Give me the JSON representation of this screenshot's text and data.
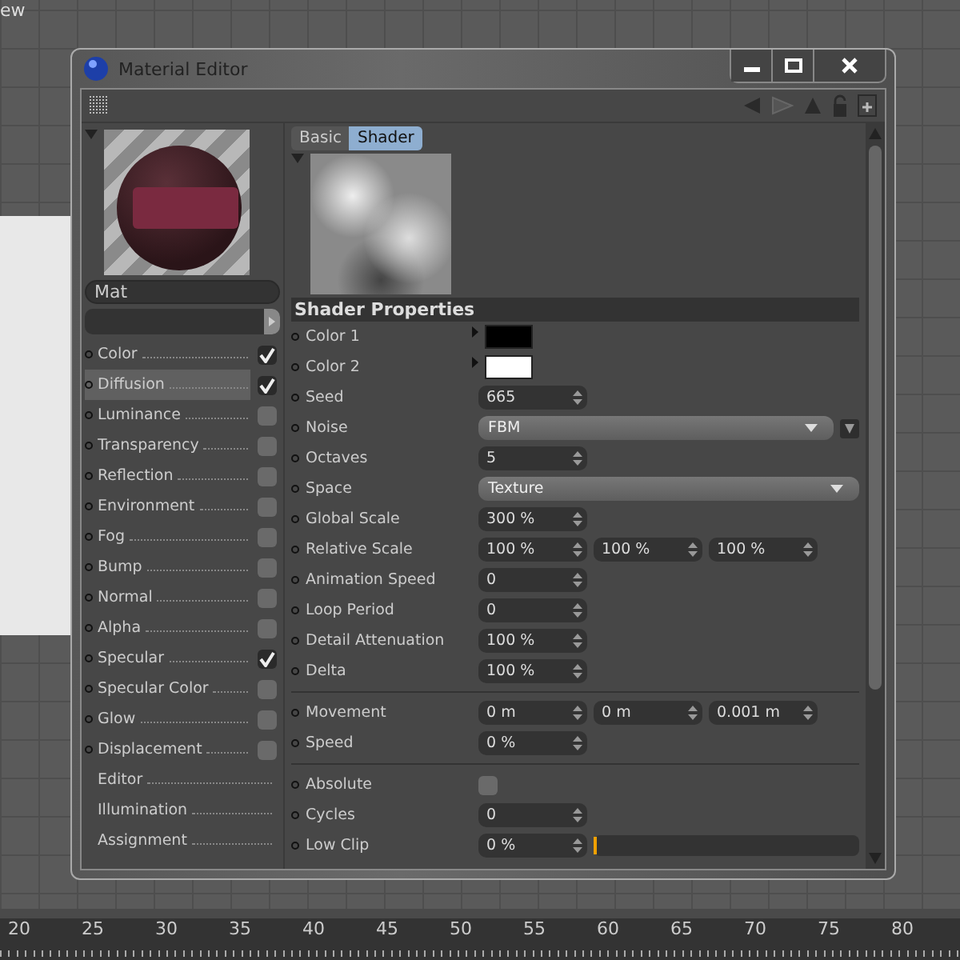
{
  "viewport": {
    "menu_label": "ew"
  },
  "window": {
    "title": "Material Editor"
  },
  "material": {
    "name": "Mat"
  },
  "channels": [
    {
      "kind": "channel",
      "label": "Color",
      "checked": true,
      "selected": false
    },
    {
      "kind": "channel",
      "label": "Diffusion",
      "checked": true,
      "selected": true
    },
    {
      "kind": "channel",
      "label": "Luminance",
      "checked": false,
      "selected": false
    },
    {
      "kind": "channel",
      "label": "Transparency",
      "checked": false,
      "selected": false
    },
    {
      "kind": "channel",
      "label": "Reflection",
      "checked": false,
      "selected": false
    },
    {
      "kind": "channel",
      "label": "Environment",
      "checked": false,
      "selected": false
    },
    {
      "kind": "channel",
      "label": "Fog",
      "checked": false,
      "selected": false
    },
    {
      "kind": "channel",
      "label": "Bump",
      "checked": false,
      "selected": false
    },
    {
      "kind": "channel",
      "label": "Normal",
      "checked": false,
      "selected": false
    },
    {
      "kind": "channel",
      "label": "Alpha",
      "checked": false,
      "selected": false
    },
    {
      "kind": "channel",
      "label": "Specular",
      "checked": true,
      "selected": false
    },
    {
      "kind": "channel",
      "label": "Specular Color",
      "checked": false,
      "selected": false
    },
    {
      "kind": "channel",
      "label": "Glow",
      "checked": false,
      "selected": false
    },
    {
      "kind": "channel",
      "label": "Displacement",
      "checked": false,
      "selected": false
    },
    {
      "kind": "page",
      "label": "Editor",
      "selected": false
    },
    {
      "kind": "page",
      "label": "Illumination",
      "selected": false
    },
    {
      "kind": "page",
      "label": "Assignment",
      "selected": false
    }
  ],
  "tabs": [
    {
      "label": "Basic",
      "selected": false
    },
    {
      "label": "Shader",
      "selected": true
    }
  ],
  "section": {
    "title": "Shader Properties"
  },
  "groups": [
    [
      {
        "kind": "color",
        "label": "Color 1",
        "color": "#000000"
      },
      {
        "kind": "color",
        "label": "Color 2",
        "color": "#ffffff"
      },
      {
        "kind": "number",
        "label": "Seed",
        "values": [
          "665"
        ]
      },
      {
        "kind": "dropdown",
        "label": "Noise",
        "value": "FBM",
        "extra": true
      },
      {
        "kind": "number",
        "label": "Octaves",
        "values": [
          "5"
        ]
      },
      {
        "kind": "dropdown",
        "label": "Space",
        "value": "Texture",
        "extra": false
      },
      {
        "kind": "number",
        "label": "Global Scale",
        "values": [
          "300 %"
        ]
      },
      {
        "kind": "number",
        "label": "Relative Scale",
        "values": [
          "100 %",
          "100 %",
          "100 %"
        ]
      },
      {
        "kind": "number",
        "label": "Animation Speed",
        "values": [
          "0"
        ]
      },
      {
        "kind": "number",
        "label": "Loop Period",
        "values": [
          "0"
        ]
      },
      {
        "kind": "number",
        "label": "Detail Attenuation",
        "values": [
          "100 %"
        ]
      },
      {
        "kind": "number",
        "label": "Delta",
        "values": [
          "100 %"
        ]
      }
    ],
    [
      {
        "kind": "number",
        "label": "Movement",
        "values": [
          "0 m",
          "0 m",
          "0.001 m"
        ]
      },
      {
        "kind": "number",
        "label": "Speed",
        "values": [
          "0 %"
        ]
      }
    ],
    [
      {
        "kind": "checkbox",
        "label": "Absolute",
        "checked": false
      },
      {
        "kind": "number",
        "label": "Cycles",
        "values": [
          "0"
        ]
      },
      {
        "kind": "slider",
        "label": "Low Clip",
        "values": [
          "0 %"
        ],
        "level": 0
      }
    ]
  ],
  "timeline": {
    "ticks": [
      "20",
      "25",
      "30",
      "35",
      "40",
      "45",
      "50",
      "55",
      "60",
      "65",
      "70",
      "75",
      "80"
    ]
  }
}
